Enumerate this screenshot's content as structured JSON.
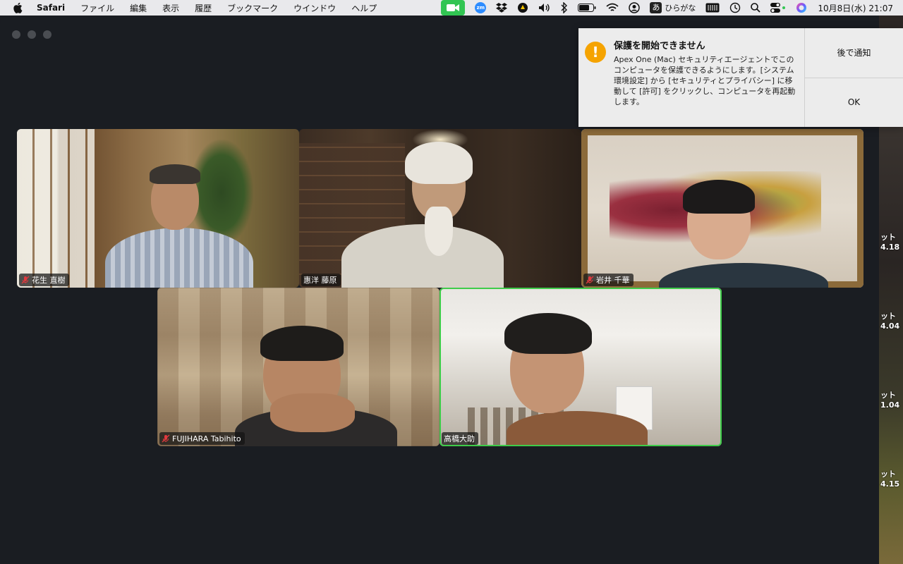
{
  "menubar": {
    "app_name": "Safari",
    "menus": [
      "ファイル",
      "編集",
      "表示",
      "履歴",
      "ブックマーク",
      "ウインドウ",
      "ヘルプ"
    ],
    "zoom_icon_label": "zm",
    "input_mode_box": "あ",
    "input_mode_label": "ひらがな",
    "datetime": "10月8日(水)  21:07"
  },
  "desktop": {
    "labels": [
      {
        "line1": "ット",
        "line2": "4.18"
      },
      {
        "line1": "ット",
        "line2": "4.04"
      },
      {
        "line1": "ット",
        "line2": "1.04"
      },
      {
        "line1": "ット",
        "line2": "4.15"
      }
    ]
  },
  "participants": [
    {
      "name": "花生 直樹",
      "muted": true
    },
    {
      "name": "惠洋 藤原",
      "muted": false
    },
    {
      "name": "岩井 千華",
      "muted": true
    },
    {
      "name": "FUJIHARA Tabihito",
      "muted": true
    },
    {
      "name": "高橋大助",
      "muted": false,
      "active_speaker": true
    }
  ],
  "notification": {
    "title": "保護を開始できません",
    "body": "Apex One (Mac) セキュリティエージェントでこのコンピュータを保護できるようにします。[システム環境設定] から [セキュリティとプライバシー] に移動して [許可] をクリックし、コンピュータを再起動します。",
    "later_button": "後で通知",
    "ok_button": "OK"
  },
  "colors": {
    "active_speaker_border": "#3fcc4a",
    "muted_icon": "#e0393e",
    "warning_icon": "#f5a300",
    "facetime_green": "#32c553"
  }
}
